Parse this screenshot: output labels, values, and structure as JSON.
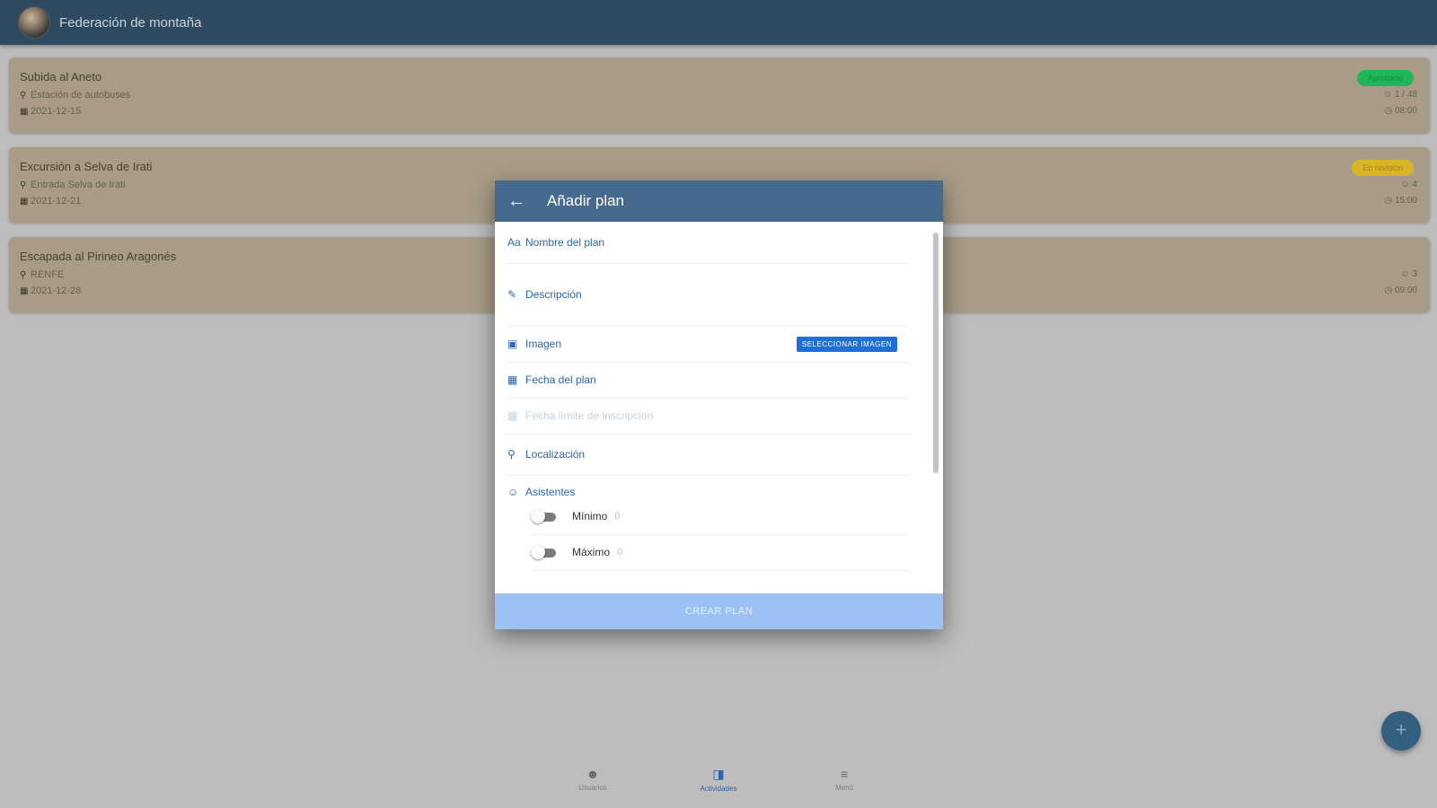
{
  "app": {
    "title": "Federación de montaña"
  },
  "plans": [
    {
      "name": "Subida al Aneto",
      "location": "Estación de autobuses",
      "date": "2021-12-15",
      "status": "Aprobado",
      "attendees": "1 / 48",
      "time": "08:00"
    },
    {
      "name": "Excursión a Selva de Irati",
      "location": "Entrada Selva de Irati",
      "date": "2021-12-21",
      "status": "En revisión",
      "attendees": "4",
      "time": "15:00"
    },
    {
      "name": "Escapada al Pirineo Aragonés",
      "location": "RENFE",
      "date": "2021-12-28",
      "status": "",
      "attendees": "3",
      "time": "09:00"
    }
  ],
  "dialog": {
    "title": "Añadir plan",
    "fields": {
      "name": "Nombre del plan",
      "description": "Descripción",
      "image": "Imagen",
      "select_image": "SELECCIONAR IMAGEN",
      "plan_date": "Fecha del plan",
      "deadline": "Fecha límite de inscripción",
      "location": "Localización",
      "attendees": "Asistentes"
    },
    "toggles": {
      "min_label": "Mínimo",
      "min_value": "0",
      "max_label": "Máximo",
      "max_value": "0"
    },
    "create_button": "CREAR PLAN"
  },
  "fab_label": "+",
  "nav": [
    {
      "label": "Usuarios",
      "icon": "users-icon"
    },
    {
      "label": "Actividades",
      "icon": "book-icon"
    },
    {
      "label": "Menú",
      "icon": "menu-icon"
    }
  ],
  "colors": {
    "topbar": "#2f4a5f",
    "card": "#a89c86",
    "dialog_header": "#456a8d",
    "primary": "#2c64b0",
    "approved": "#1fb65a",
    "review": "#d9b526"
  }
}
